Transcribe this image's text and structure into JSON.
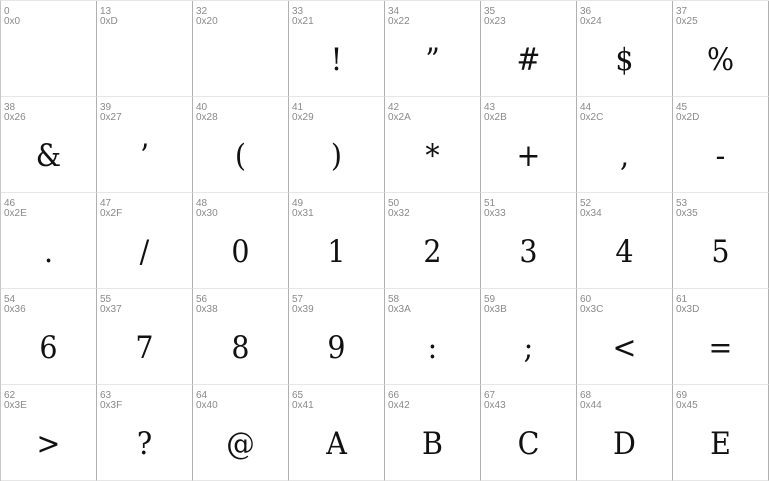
{
  "cells": [
    {
      "dec": "0",
      "hex": "0x0",
      "glyph": ""
    },
    {
      "dec": "13",
      "hex": "0xD",
      "glyph": ""
    },
    {
      "dec": "32",
      "hex": "0x20",
      "glyph": ""
    },
    {
      "dec": "33",
      "hex": "0x21",
      "glyph": "!"
    },
    {
      "dec": "34",
      "hex": "0x22",
      "glyph": "”"
    },
    {
      "dec": "35",
      "hex": "0x23",
      "glyph": "#"
    },
    {
      "dec": "36",
      "hex": "0x24",
      "glyph": "$"
    },
    {
      "dec": "37",
      "hex": "0x25",
      "glyph": "%"
    },
    {
      "dec": "38",
      "hex": "0x26",
      "glyph": "&"
    },
    {
      "dec": "39",
      "hex": "0x27",
      "glyph": "’"
    },
    {
      "dec": "40",
      "hex": "0x28",
      "glyph": "("
    },
    {
      "dec": "41",
      "hex": "0x29",
      "glyph": ")"
    },
    {
      "dec": "42",
      "hex": "0x2A",
      "glyph": "*"
    },
    {
      "dec": "43",
      "hex": "0x2B",
      "glyph": "+"
    },
    {
      "dec": "44",
      "hex": "0x2C",
      "glyph": ","
    },
    {
      "dec": "45",
      "hex": "0x2D",
      "glyph": "-"
    },
    {
      "dec": "46",
      "hex": "0x2E",
      "glyph": "."
    },
    {
      "dec": "47",
      "hex": "0x2F",
      "glyph": "/"
    },
    {
      "dec": "48",
      "hex": "0x30",
      "glyph": "0"
    },
    {
      "dec": "49",
      "hex": "0x31",
      "glyph": "1"
    },
    {
      "dec": "50",
      "hex": "0x32",
      "glyph": "2"
    },
    {
      "dec": "51",
      "hex": "0x33",
      "glyph": "3"
    },
    {
      "dec": "52",
      "hex": "0x34",
      "glyph": "4"
    },
    {
      "dec": "53",
      "hex": "0x35",
      "glyph": "5"
    },
    {
      "dec": "54",
      "hex": "0x36",
      "glyph": "6"
    },
    {
      "dec": "55",
      "hex": "0x37",
      "glyph": "7"
    },
    {
      "dec": "56",
      "hex": "0x38",
      "glyph": "8"
    },
    {
      "dec": "57",
      "hex": "0x39",
      "glyph": "9"
    },
    {
      "dec": "58",
      "hex": "0x3A",
      "glyph": ":"
    },
    {
      "dec": "59",
      "hex": "0x3B",
      "glyph": ";"
    },
    {
      "dec": "60",
      "hex": "0x3C",
      "glyph": "<"
    },
    {
      "dec": "61",
      "hex": "0x3D",
      "glyph": "="
    },
    {
      "dec": "62",
      "hex": "0x3E",
      "glyph": ">"
    },
    {
      "dec": "63",
      "hex": "0x3F",
      "glyph": "?"
    },
    {
      "dec": "64",
      "hex": "0x40",
      "glyph": "@"
    },
    {
      "dec": "65",
      "hex": "0x41",
      "glyph": "A"
    },
    {
      "dec": "66",
      "hex": "0x42",
      "glyph": "B"
    },
    {
      "dec": "67",
      "hex": "0x43",
      "glyph": "C"
    },
    {
      "dec": "68",
      "hex": "0x44",
      "glyph": "D"
    },
    {
      "dec": "69",
      "hex": "0x45",
      "glyph": "E"
    }
  ]
}
